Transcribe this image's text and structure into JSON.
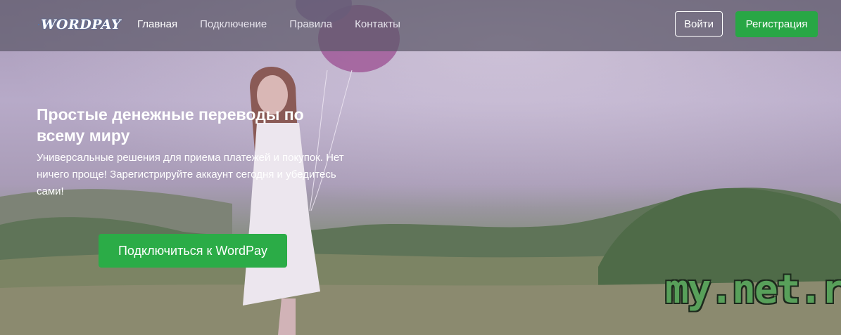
{
  "brand": {
    "name": "WORDPAY"
  },
  "nav": {
    "items": [
      {
        "label": "Главная",
        "active": true
      },
      {
        "label": "Подключение",
        "active": false
      },
      {
        "label": "Правила",
        "active": false
      },
      {
        "label": "Контакты",
        "active": false
      }
    ],
    "login_label": "Войти",
    "register_label": "Регистрация"
  },
  "hero": {
    "title": "Простые денежные переводы по всему миру",
    "subtitle": "Универсальные решения для приема платежей и покупок. Нет ничего проще! Зарегистрируйте аккаунт сегодня и убедитесь сами!",
    "cta_label": "Подключиться к WordPay"
  },
  "watermark": {
    "text": "my.net.ru"
  },
  "colors": {
    "accent_green": "#28a745",
    "navbar_bg": "#5c5868"
  }
}
